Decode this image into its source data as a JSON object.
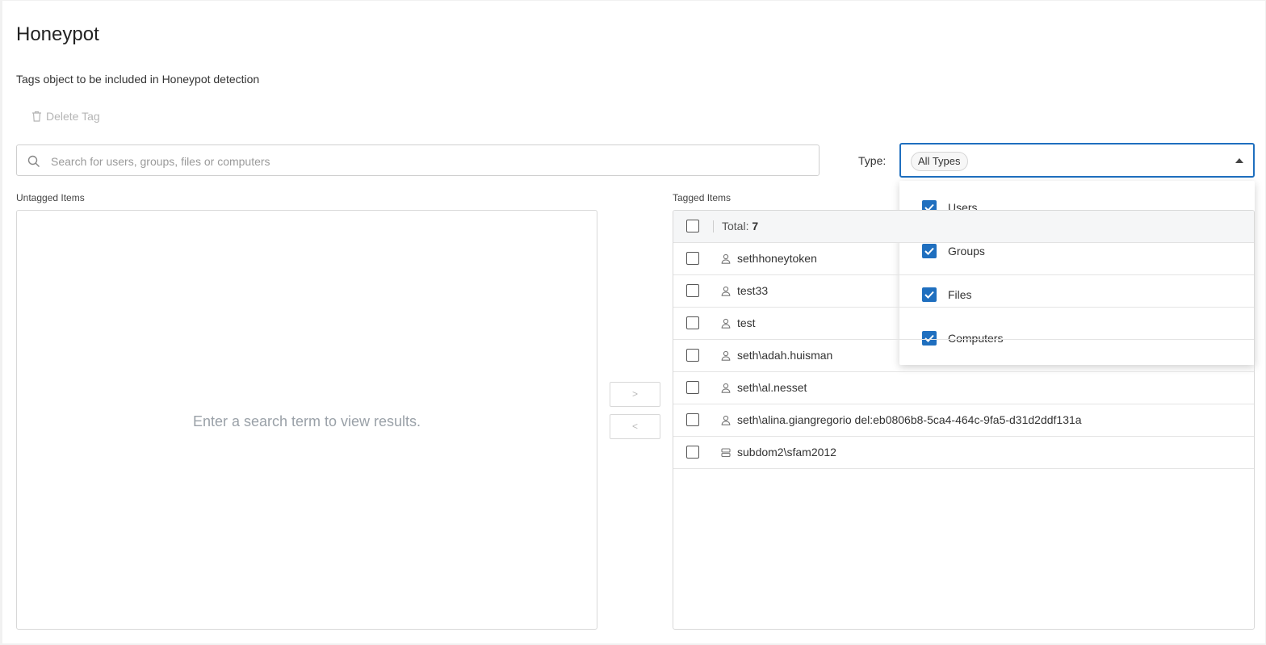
{
  "page": {
    "title": "Honeypot",
    "subtitle": "Tags object to be included in Honeypot detection",
    "delete_tag_label": "Delete Tag"
  },
  "search": {
    "placeholder": "Search for users, groups, files or computers",
    "value": ""
  },
  "type_filter": {
    "label": "Type:",
    "selected_chip": "All Types",
    "options": [
      {
        "label": "Users",
        "checked": true
      },
      {
        "label": "Groups",
        "checked": true
      },
      {
        "label": "Files",
        "checked": true
      },
      {
        "label": "Computers",
        "checked": true
      }
    ]
  },
  "untagged": {
    "label": "Untagged Items",
    "empty_message": "Enter a search term to view results."
  },
  "move_buttons": {
    "add": ">",
    "remove": "<"
  },
  "tagged": {
    "label": "Tagged Items",
    "total_label": "Total:",
    "total_count": "7",
    "rows": [
      {
        "name": "sethhoneytoken",
        "icon": "user-icon"
      },
      {
        "name": "test33",
        "icon": "user-icon"
      },
      {
        "name": "test",
        "icon": "user-icon"
      },
      {
        "name": "seth\\adah.huisman",
        "icon": "user-icon"
      },
      {
        "name": "seth\\al.nesset",
        "icon": "user-icon"
      },
      {
        "name": "seth\\alina.giangregorio del:eb0806b8-5ca4-464c-9fa5-d31d2ddf131a",
        "icon": "user-icon"
      },
      {
        "name": "subdom2\\sfam2012",
        "icon": "computer-icon"
      }
    ]
  },
  "colors": {
    "accent": "#1f6fbf",
    "border": "#d8d8d8",
    "muted_text": "#9aa1a8"
  }
}
